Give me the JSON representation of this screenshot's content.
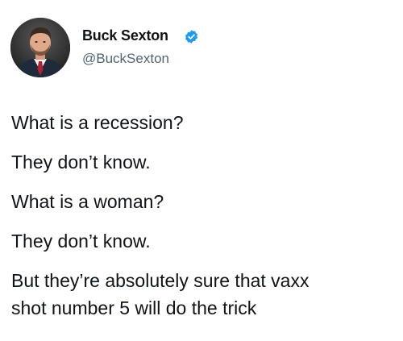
{
  "author": {
    "display_name": "Buck Sexton",
    "handle": "@BuckSexton",
    "verified": true,
    "verified_color": "#1d9bf0"
  },
  "tweet": {
    "lines": [
      "What is a recession?",
      "They don’t know.",
      "What is a woman?",
      "They don’t know."
    ],
    "last_line_1": "But they’re absolutely sure that vaxx",
    "last_line_2": "shot number 5 will do the trick"
  },
  "icons": {
    "avatar": "avatar-photo",
    "verified": "verified-badge-icon"
  }
}
